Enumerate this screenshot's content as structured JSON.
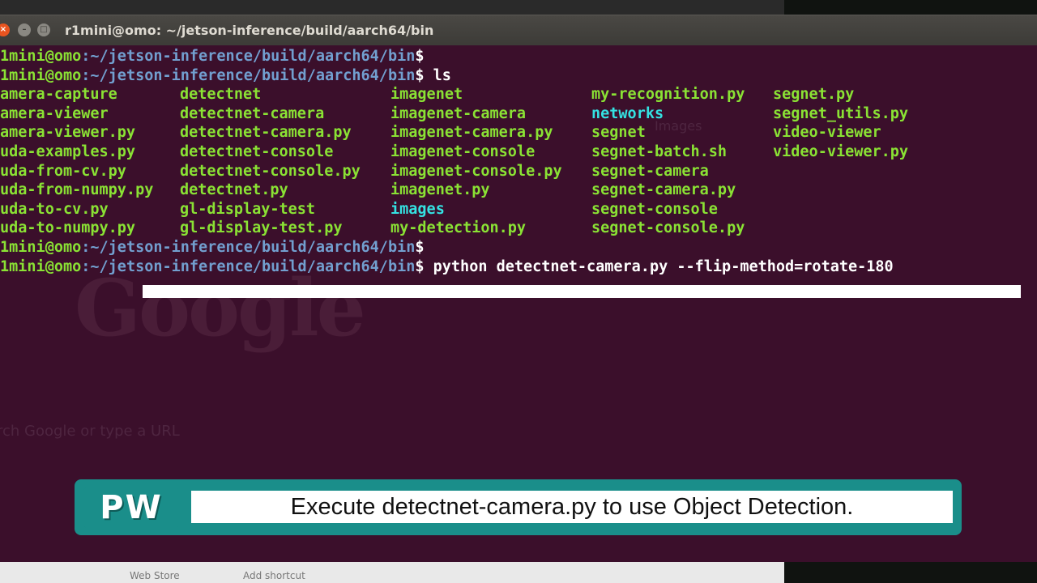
{
  "window": {
    "title": "r1mini@omo: ~/jetson-inference/build/aarch64/bin",
    "close_glyph": "×",
    "min_glyph": "–",
    "max_glyph": "□"
  },
  "background": {
    "search_ghost": "rch Google or type a URL",
    "google_ghost": "Google",
    "images_ghost": "Images",
    "bottom_left": "Web Store",
    "bottom_right": "Add shortcut"
  },
  "terminal": {
    "prompt_user": "1mini@omo",
    "prompt_path": ":~/jetson-inference/build/aarch64/bin",
    "prompt_symbol": "$",
    "commands": [
      "",
      " ls",
      "",
      " python detectnet-camera.py --flip-method=rotate-180"
    ],
    "ls_columns": [
      [
        "amera-capture",
        "amera-viewer",
        "amera-viewer.py",
        "uda-examples.py",
        "uda-from-cv.py",
        "uda-from-numpy.py",
        "uda-to-cv.py",
        "uda-to-numpy.py"
      ],
      [
        "detectnet",
        "detectnet-camera",
        "detectnet-camera.py",
        "detectnet-console",
        "detectnet-console.py",
        "detectnet.py",
        "gl-display-test",
        "gl-display-test.py"
      ],
      [
        "imagenet",
        "imagenet-camera",
        "imagenet-camera.py",
        "imagenet-console",
        "imagenet-console.py",
        "imagenet.py",
        "images",
        "my-detection.py"
      ],
      [
        "my-recognition.py",
        "networks",
        "segnet",
        "segnet-batch.sh",
        "segnet-camera",
        "segnet-camera.py",
        "segnet-console",
        "segnet-console.py"
      ],
      [
        "segnet.py",
        "segnet_utils.py",
        "video-viewer",
        "video-viewer.py"
      ]
    ],
    "directories": [
      "networks",
      "images"
    ],
    "colors": {
      "background": "#3b0f2b",
      "executable": "#8ae234",
      "directory": "#34e2e2",
      "prompt_path": "#729fcf"
    }
  },
  "caption": {
    "logo": "PW",
    "text": "Execute detectnet-camera.py to use Object Detection.",
    "accent": "#1a8e8a"
  }
}
